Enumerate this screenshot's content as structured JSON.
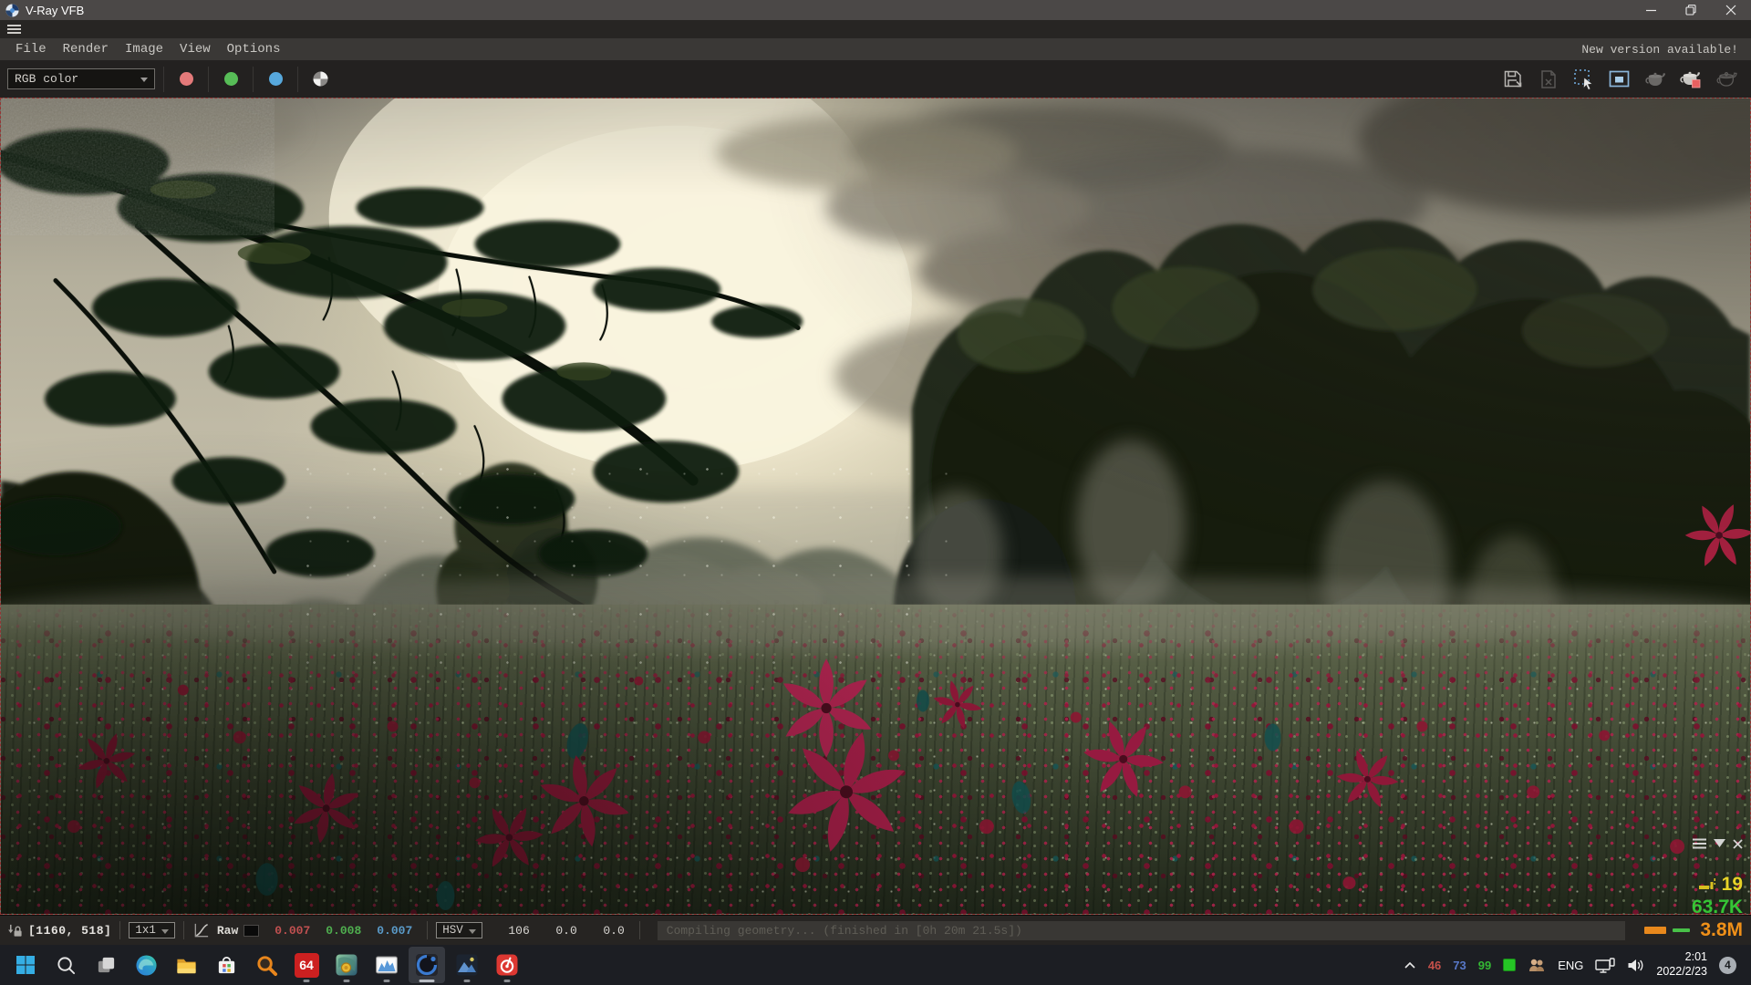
{
  "window": {
    "title": "V-Ray VFB"
  },
  "menu": {
    "items": [
      "File",
      "Render",
      "Image",
      "View",
      "Options"
    ],
    "notice": "New version available!"
  },
  "toolbar": {
    "channel": "RGB color"
  },
  "statusbar": {
    "coords": "[1160, 518]",
    "zoom": "1x1",
    "raw_label": "Raw",
    "r": "0.007",
    "g": "0.008",
    "b": "0.007",
    "color_mode": "HSV",
    "h": "106",
    "s": "0.0",
    "v": "0.0",
    "progress": "Compiling geometry... (finished in [0h 20m 21.5s])"
  },
  "stats": {
    "row1": "19",
    "row2": "63.7K",
    "row3": "3.8M"
  },
  "taskbar": {
    "app64_label": "64",
    "tray": {
      "stat_red": "46",
      "stat_blue": "73",
      "stat_green": "99",
      "lang": "ENG",
      "time": "2:01",
      "date": "2022/2/23",
      "badge": "4"
    }
  },
  "colors": {
    "stat_yellow": "#e8d428",
    "stat_green": "#35c535",
    "stat_orange": "#f09018",
    "raw_r": "#c05050",
    "raw_g": "#4fae4f",
    "raw_b": "#5a9ac8",
    "channel_red": "#e47a7a",
    "channel_green": "#57bd57",
    "channel_blue": "#57a8dc"
  }
}
